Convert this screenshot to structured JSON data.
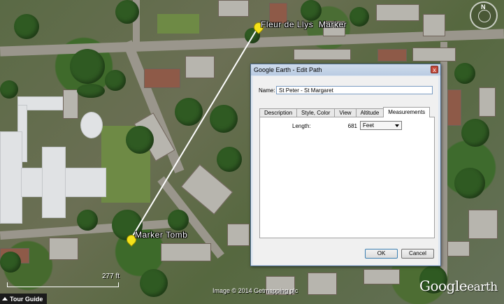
{
  "map": {
    "placemarks": [
      {
        "label": "Fleur de Llys  Marker"
      },
      {
        "label": "Marker Tomb"
      }
    ],
    "scale_label": "277 ft",
    "copyright": "Image © 2014 Getmapping plc",
    "logo": {
      "google": "Google",
      "earth": "earth"
    },
    "compass_north": "N",
    "path_color": "#ffffff",
    "pin_color": "#f4e21a"
  },
  "tour_guide": {
    "label": "Tour Guide"
  },
  "dialog": {
    "title": "Google Earth - Edit Path",
    "close_label": "x",
    "name_label": "Name:",
    "name_value": "St Peter - St Margaret",
    "tabs": [
      {
        "label": "Description"
      },
      {
        "label": "Style, Color"
      },
      {
        "label": "View"
      },
      {
        "label": "Altitude"
      },
      {
        "label": "Measurements",
        "active": true
      }
    ],
    "measurements": {
      "length_label": "Length:",
      "length_value": "681",
      "unit_selected": "Feet"
    },
    "ok_label": "OK",
    "cancel_label": "Cancel"
  }
}
